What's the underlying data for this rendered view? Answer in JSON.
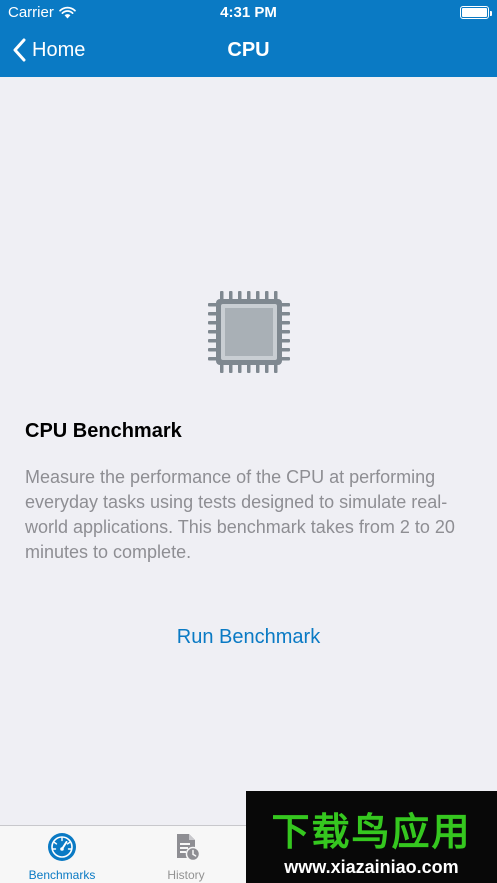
{
  "status_bar": {
    "carrier": "Carrier",
    "time": "4:31 PM",
    "icons": [
      "wifi-icon",
      "battery-icon"
    ]
  },
  "nav": {
    "back_label": "Home",
    "title": "CPU"
  },
  "benchmark": {
    "icon": "cpu-chip-icon",
    "title": "CPU Benchmark",
    "description": "Measure the performance of the CPU at performing everyday tasks using tests designed to simulate real-world applications. This benchmark takes from 2 to 20 minutes to complete.",
    "run_label": "Run Benchmark"
  },
  "tabs": [
    {
      "label": "Benchmarks",
      "icon": "speedometer-icon",
      "active": true
    },
    {
      "label": "History",
      "icon": "document-clock-icon",
      "active": false
    }
  ],
  "watermark": {
    "text_cn": "下载鸟应用",
    "url": "www.xiazainiao.com"
  },
  "colors": {
    "accent": "#0a7ac4",
    "background": "#efeff4",
    "secondary_text": "#8e8e93",
    "chip_gray": "#7f8890",
    "watermark_green": "#35c71f"
  }
}
